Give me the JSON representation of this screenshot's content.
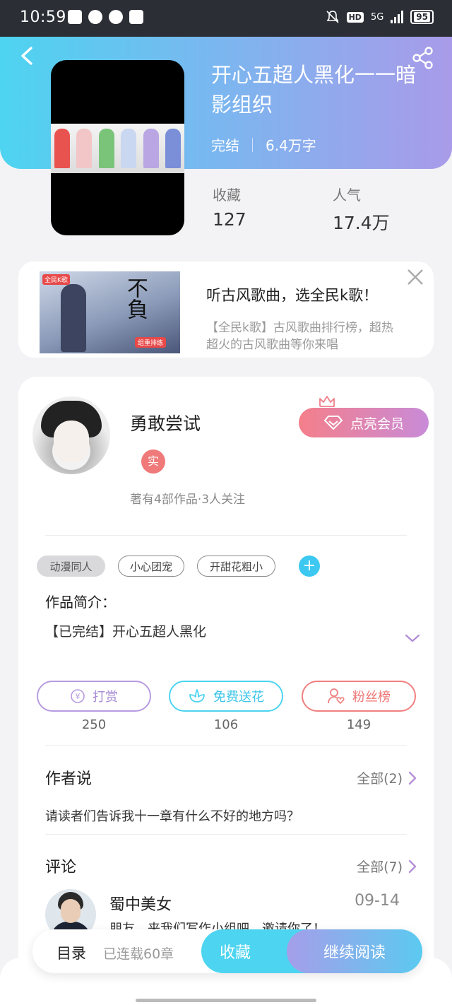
{
  "status_bar": {
    "time": "10:59",
    "network": "5G",
    "battery": "95",
    "hd_label": "HD"
  },
  "book": {
    "title": "开心五超人黑化一一暗影组织",
    "status": "完结",
    "word_count": "6.4万字",
    "stats": [
      {
        "label": "收藏",
        "value": "127"
      },
      {
        "label": "人气",
        "value": "17.4万"
      }
    ]
  },
  "ad": {
    "title": "听古风歌曲，选全民k歌！",
    "desc_line1": "【全民k歌】古风歌曲排行榜，超热",
    "desc_line2": "超火的古风歌曲等你来唱",
    "image_text": "不負",
    "image_logo": "全民K歌",
    "image_tag": "组重排练"
  },
  "author": {
    "name": "勇敢尝试",
    "badge": "实",
    "meta": "著有4部作品·3人关注",
    "vip_label": "点亮会员"
  },
  "tags": [
    "动漫同人",
    "小心团宠",
    "开甜花粗小"
  ],
  "tag_add": "+",
  "intro": {
    "label": "作品简介：",
    "text": "【已完结】开心五超人黑化"
  },
  "actions": [
    {
      "label": "打赏",
      "count": "250",
      "color": "#b79be0"
    },
    {
      "label": "免费送花",
      "count": "106",
      "color": "#4dd4f0"
    },
    {
      "label": "粉丝榜",
      "count": "149",
      "color": "#f07f7f"
    }
  ],
  "author_says": {
    "title": "作者说",
    "more": "全部(2)",
    "text": "请读者们告诉我十一章有什么不好的地方吗？"
  },
  "comments": {
    "title": "评论",
    "more": "全部(7)",
    "items": [
      {
        "name": "蜀中美女",
        "date": "09-14",
        "text": "朋友，来我们写作小组吧，邀请你了！"
      }
    ]
  },
  "bottom_bar": {
    "toc": "目录",
    "chapters": "已连载60章",
    "favorite": "收藏",
    "continue_reading": "继续阅读"
  },
  "colors": {
    "accent_cyan": "#4dd4f0",
    "accent_purple": "#a99be9",
    "badge_red": "#f0797a"
  }
}
